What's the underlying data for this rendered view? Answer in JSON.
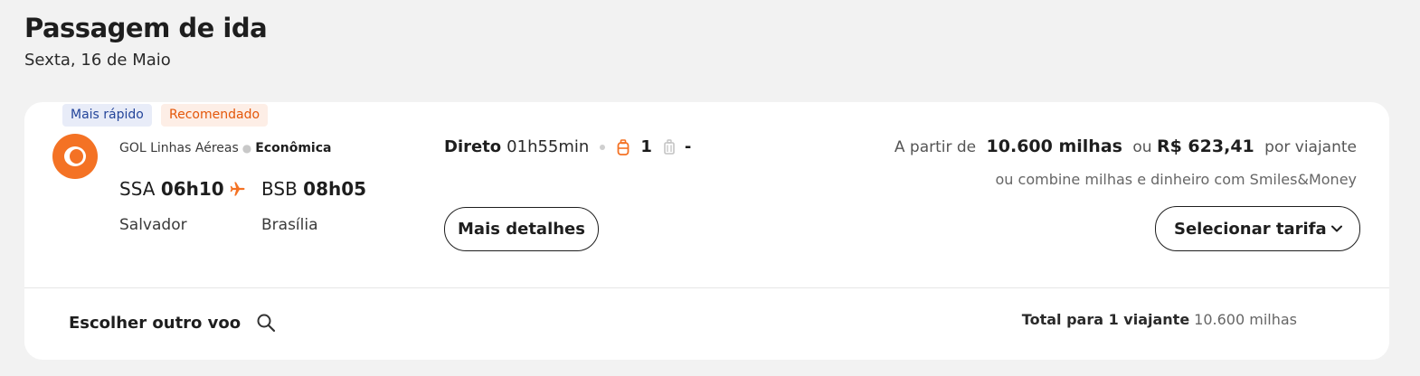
{
  "page": {
    "title": "Passagem de ida",
    "date": "Sexta, 16 de Maio"
  },
  "flight": {
    "badges": {
      "fastest": "Mais rápido",
      "recommended": "Recomendado"
    },
    "airline": "GOL Linhas Aéreas",
    "cabin": "Econômica",
    "origin": {
      "code": "SSA",
      "time": "06h10",
      "city": "Salvador"
    },
    "destination": {
      "code": "BSB",
      "time": "08h05",
      "city": "Brasília"
    },
    "type": "Direto",
    "duration": "01h55min",
    "carry_on_count": "1",
    "checked_bag_count": "-",
    "details_label": "Mais detalhes",
    "price": {
      "prefix": "A partir de",
      "miles": "10.600 milhas",
      "or": "ou",
      "money": "R$ 623,41",
      "per": "por viajante",
      "combo": "ou combine milhas e dinheiro com Smiles&Money"
    },
    "select_label": "Selecionar tarifa"
  },
  "footer": {
    "other_flight_label": "Escolher outro voo",
    "total_label": "Total para 1 viajante",
    "total_value": "10.600 milhas"
  },
  "colors": {
    "accent": "#f47224",
    "badge_fast_text": "#24459a",
    "badge_fast_bg": "#e8ecf8",
    "badge_recommended_text": "#e4570a",
    "badge_recommended_bg": "#fdeee6"
  },
  "icons": [
    "airline-logo",
    "plane-icon",
    "backpack-icon",
    "suitcase-icon",
    "chevron-down-icon",
    "search-icon"
  ]
}
